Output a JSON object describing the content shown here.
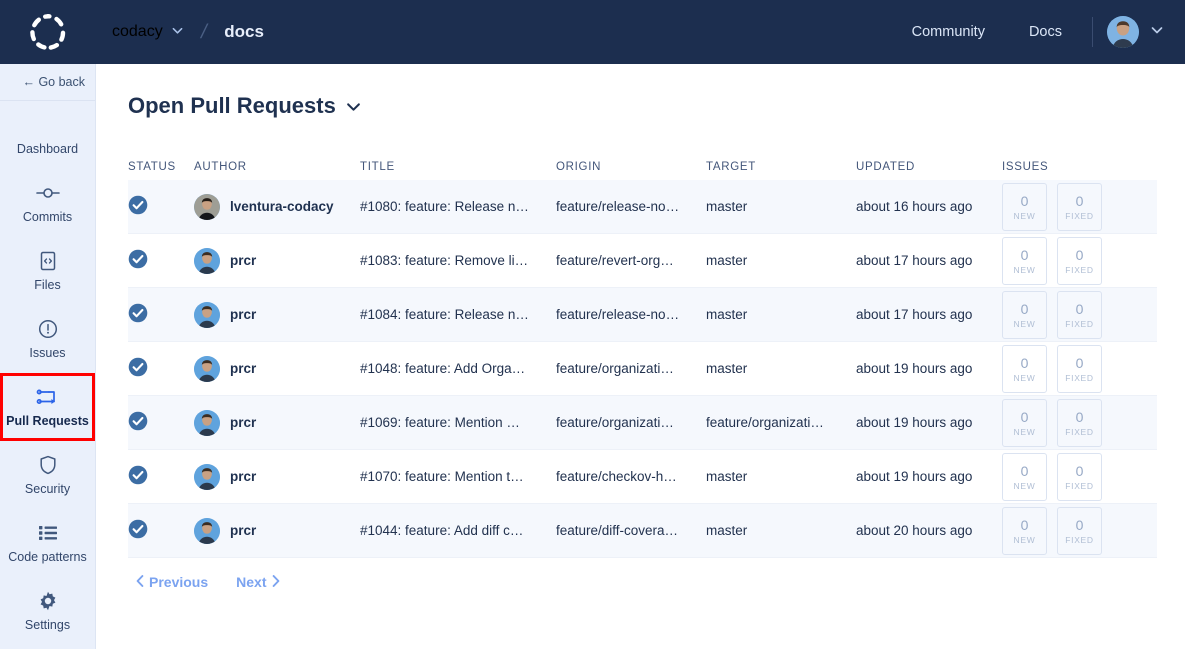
{
  "header": {
    "logo_icon": "codacy-dashed-circle-logo",
    "org": "codacy",
    "org_chevron_icon": "chevron-down-icon",
    "separator": "/",
    "repo": "docs",
    "nav": [
      {
        "label": "Community",
        "name": "community-link"
      },
      {
        "label": "Docs",
        "name": "docs-link"
      }
    ],
    "avatar_icon": "user-avatar",
    "avatar_chevron_icon": "chevron-down-icon"
  },
  "sidebar": {
    "go_back": "← Go back",
    "items": [
      {
        "label": "Dashboard",
        "icon": "chart-line-icon",
        "active": false
      },
      {
        "label": "Commits",
        "icon": "commit-node-icon",
        "active": false
      },
      {
        "label": "Files",
        "icon": "file-code-icon",
        "active": false
      },
      {
        "label": "Issues",
        "icon": "alert-circle-icon",
        "active": false
      },
      {
        "label": "Pull Requests",
        "icon": "git-branch-icon",
        "active": true
      },
      {
        "label": "Security",
        "icon": "shield-icon",
        "active": false
      },
      {
        "label": "Code patterns",
        "icon": "list-icon",
        "active": false
      },
      {
        "label": "Settings",
        "icon": "gear-icon",
        "active": false
      }
    ],
    "highlight_color": "#ff0000"
  },
  "main": {
    "title": "Open Pull Requests",
    "title_chevron_icon": "chevron-down-icon",
    "columns": {
      "status": "STATUS",
      "author": "AUTHOR",
      "title": "TITLE",
      "origin": "ORIGIN",
      "target": "TARGET",
      "updated": "UPDATED",
      "issues": "ISSUES"
    },
    "rows": [
      {
        "status_icon": "check-circle-icon",
        "author": "lventura-codacy",
        "title": "#1080: feature: Release n…",
        "origin": "feature/release-no…",
        "target": "master",
        "updated": "about 16 hours ago",
        "new_count": "0",
        "new_label": "NEW",
        "fixed_count": "0",
        "fixed_label": "FIXED"
      },
      {
        "status_icon": "check-circle-icon",
        "author": "prcr",
        "title": "#1083: feature: Remove li…",
        "origin": "feature/revert-org…",
        "target": "master",
        "updated": "about 17 hours ago",
        "new_count": "0",
        "new_label": "NEW",
        "fixed_count": "0",
        "fixed_label": "FIXED"
      },
      {
        "status_icon": "check-circle-icon",
        "author": "prcr",
        "title": "#1084: feature: Release n…",
        "origin": "feature/release-no…",
        "target": "master",
        "updated": "about 17 hours ago",
        "new_count": "0",
        "new_label": "NEW",
        "fixed_count": "0",
        "fixed_label": "FIXED"
      },
      {
        "status_icon": "check-circle-icon",
        "author": "prcr",
        "title": "#1048: feature: Add Orga…",
        "origin": "feature/organizati…",
        "target": "master",
        "updated": "about 19 hours ago",
        "new_count": "0",
        "new_label": "NEW",
        "fixed_count": "0",
        "fixed_label": "FIXED"
      },
      {
        "status_icon": "check-circle-icon",
        "author": "prcr",
        "title": "#1069: feature: Mention …",
        "origin": "feature/organizati…",
        "target": "feature/organizati…",
        "updated": "about 19 hours ago",
        "new_count": "0",
        "new_label": "NEW",
        "fixed_count": "0",
        "fixed_label": "FIXED"
      },
      {
        "status_icon": "check-circle-icon",
        "author": "prcr",
        "title": "#1070: feature: Mention t…",
        "origin": "feature/checkov-h…",
        "target": "master",
        "updated": "about 19 hours ago",
        "new_count": "0",
        "new_label": "NEW",
        "fixed_count": "0",
        "fixed_label": "FIXED"
      },
      {
        "status_icon": "check-circle-icon",
        "author": "prcr",
        "title": "#1044: feature: Add diff c…",
        "origin": "feature/diff-covera…",
        "target": "master",
        "updated": "about 20 hours ago",
        "new_count": "0",
        "new_label": "NEW",
        "fixed_count": "0",
        "fixed_label": "FIXED"
      }
    ],
    "pagination": {
      "previous": "Previous",
      "next": "Next",
      "prev_icon": "chevron-left-icon",
      "next_icon": "chevron-right-icon"
    }
  },
  "colors": {
    "header_bg": "#1c2e4f",
    "sidebar_bg": "#eaf0fb",
    "status_blue": "#3b6ea5",
    "link_blue": "#7ba3f0",
    "highlight_red": "#ff0000"
  }
}
